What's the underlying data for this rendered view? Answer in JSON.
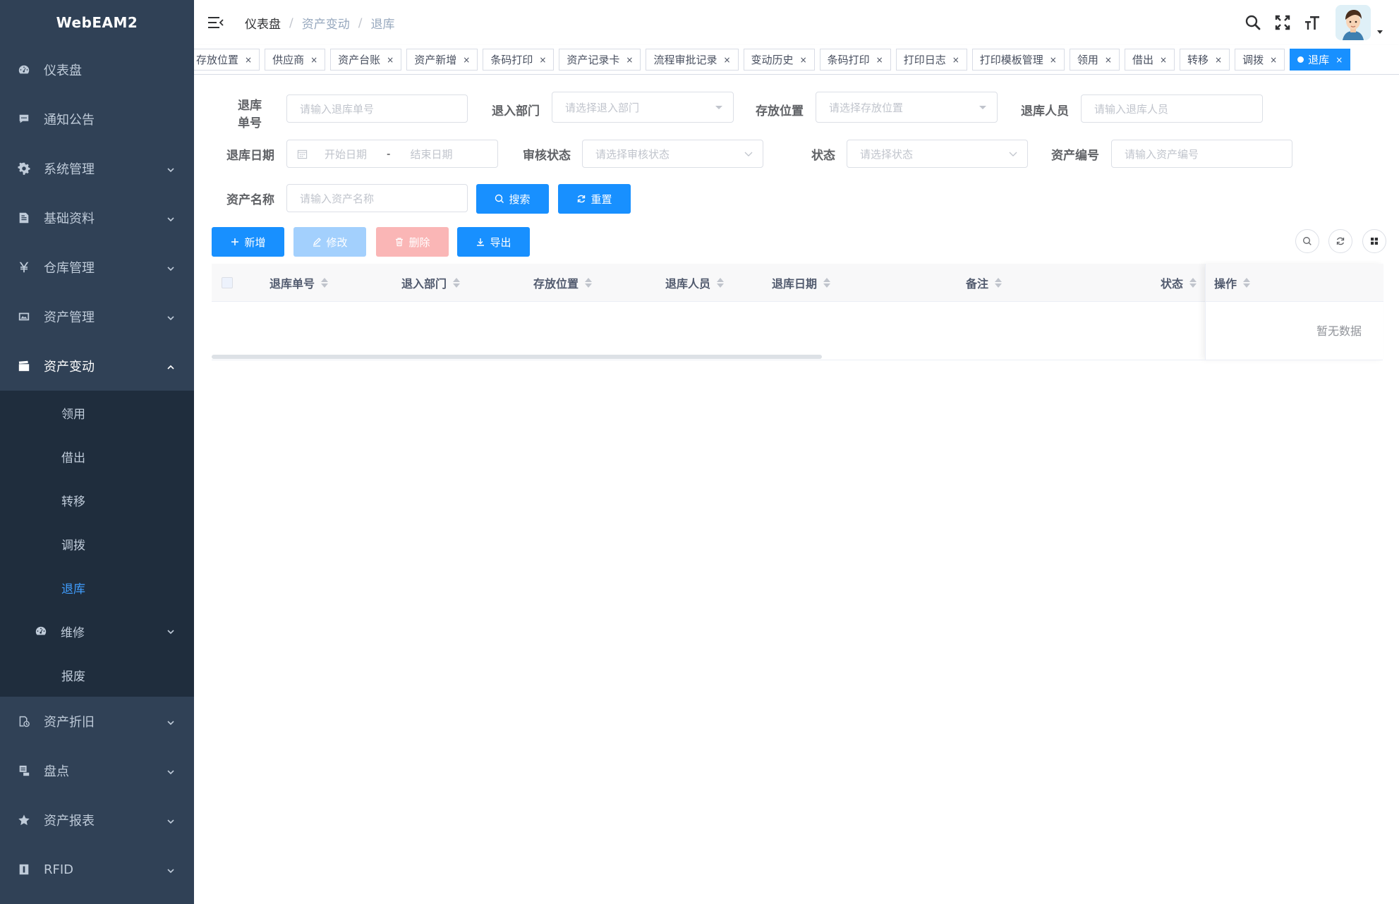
{
  "app": {
    "title": "WebEAM2"
  },
  "sidebar": {
    "items": [
      {
        "label": "仪表盘",
        "icon": "dashboard-icon",
        "has_arrow": false
      },
      {
        "label": "通知公告",
        "icon": "message-icon",
        "has_arrow": false
      },
      {
        "label": "系统管理",
        "icon": "gear-icon",
        "has_arrow": true
      },
      {
        "label": "基础资料",
        "icon": "document-icon",
        "has_arrow": true
      },
      {
        "label": "仓库管理",
        "icon": "yen-icon",
        "has_arrow": true
      },
      {
        "label": "资产管理",
        "icon": "image-icon",
        "has_arrow": true
      },
      {
        "label": "资产变动",
        "icon": "clapper-icon",
        "has_arrow": true,
        "open": true
      }
    ],
    "submenu": [
      {
        "label": "领用"
      },
      {
        "label": "借出"
      },
      {
        "label": "转移"
      },
      {
        "label": "调拨"
      },
      {
        "label": "退库",
        "active": true
      },
      {
        "label": "维修",
        "icon": "dashboard-icon",
        "has_arrow": true
      },
      {
        "label": "报废"
      }
    ],
    "items_after": [
      {
        "label": "资产折旧",
        "icon": "depreciation-icon",
        "has_arrow": true
      },
      {
        "label": "盘点",
        "icon": "inventory-icon",
        "has_arrow": true
      },
      {
        "label": "资产报表",
        "icon": "star-icon",
        "has_arrow": true
      },
      {
        "label": "RFID",
        "icon": "rfid-icon",
        "has_arrow": true
      }
    ]
  },
  "breadcrumb": [
    "仪表盘",
    "资产变动",
    "退库"
  ],
  "tags": [
    {
      "label": "存放位置"
    },
    {
      "label": "供应商"
    },
    {
      "label": "资产台账"
    },
    {
      "label": "资产新增"
    },
    {
      "label": "条码打印"
    },
    {
      "label": "资产记录卡"
    },
    {
      "label": "流程审批记录"
    },
    {
      "label": "变动历史"
    },
    {
      "label": "条码打印"
    },
    {
      "label": "打印日志"
    },
    {
      "label": "打印模板管理"
    },
    {
      "label": "领用"
    },
    {
      "label": "借出"
    },
    {
      "label": "转移"
    },
    {
      "label": "调拨"
    },
    {
      "label": "退库",
      "active": true
    }
  ],
  "form": {
    "return_no": {
      "label": "退库单号",
      "placeholder": "请输入退库单号"
    },
    "dept": {
      "label": "退入部门",
      "placeholder": "请选择退入部门"
    },
    "location": {
      "label": "存放位置",
      "placeholder": "请选择存放位置"
    },
    "person": {
      "label": "退库人员",
      "placeholder": "请输入退库人员"
    },
    "date": {
      "label": "退库日期",
      "start_placeholder": "开始日期",
      "separator": "-",
      "end_placeholder": "结束日期"
    },
    "audit_status": {
      "label": "审核状态",
      "placeholder": "请选择审核状态"
    },
    "status": {
      "label": "状态",
      "placeholder": "请选择状态"
    },
    "asset_code": {
      "label": "资产编号",
      "placeholder": "请输入资产编号"
    },
    "asset_name": {
      "label": "资产名称",
      "placeholder": "请输入资产名称"
    },
    "search_label": "搜索",
    "reset_label": "重置"
  },
  "toolbar": {
    "add": "新增",
    "edit": "修改",
    "delete": "删除",
    "export": "导出"
  },
  "table": {
    "columns": [
      "退库单号",
      "退入部门",
      "存放位置",
      "退库人员",
      "退库日期",
      "备注",
      "状态"
    ],
    "fixed_column": "操作",
    "empty_text": "暂无数据"
  },
  "colors": {
    "sidebar_bg": "#304156",
    "submenu_bg": "#1f2d3d",
    "accent": "#1890ff",
    "active_menu": "#409eff"
  }
}
